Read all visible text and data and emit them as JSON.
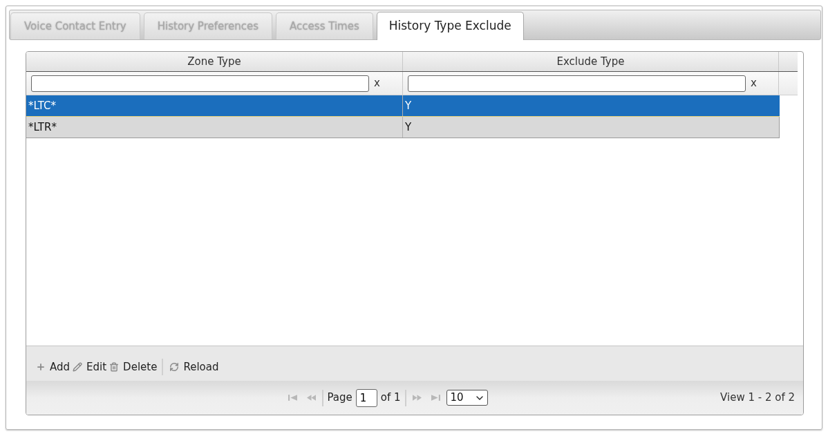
{
  "tabs": [
    {
      "label": "Voice Contact Entry",
      "selected": false
    },
    {
      "label": "History Preferences",
      "selected": false
    },
    {
      "label": "Access Times",
      "selected": false
    },
    {
      "label": "History Type Exclude",
      "selected": true
    }
  ],
  "grid": {
    "columns": [
      "Zone Type",
      "Exclude Type"
    ],
    "filters": [
      {
        "clear_label": "x"
      },
      {
        "clear_label": "x"
      }
    ],
    "rows": [
      {
        "cells": [
          "*LTC*",
          "Y"
        ],
        "selected": true
      },
      {
        "cells": [
          "*LTR*",
          "Y"
        ],
        "selected": false
      }
    ],
    "toolbar_groups": [
      [
        {
          "kind": "add",
          "label": "Add"
        },
        {
          "kind": "edit",
          "label": "Edit"
        },
        {
          "kind": "delete",
          "label": "Delete"
        }
      ],
      [
        {
          "kind": "reload",
          "label": "Reload"
        }
      ]
    ],
    "pager": {
      "nav_before": [
        {
          "kind": "first",
          "disabled": true
        },
        {
          "kind": "prev",
          "disabled": true
        }
      ],
      "page_label": "Page",
      "page": "1",
      "of_label": "of 1",
      "nav_after": [
        {
          "kind": "next",
          "disabled": true
        },
        {
          "kind": "last",
          "disabled": true
        }
      ],
      "page_size": "10",
      "summary": "View 1 - 2 of 2"
    }
  }
}
